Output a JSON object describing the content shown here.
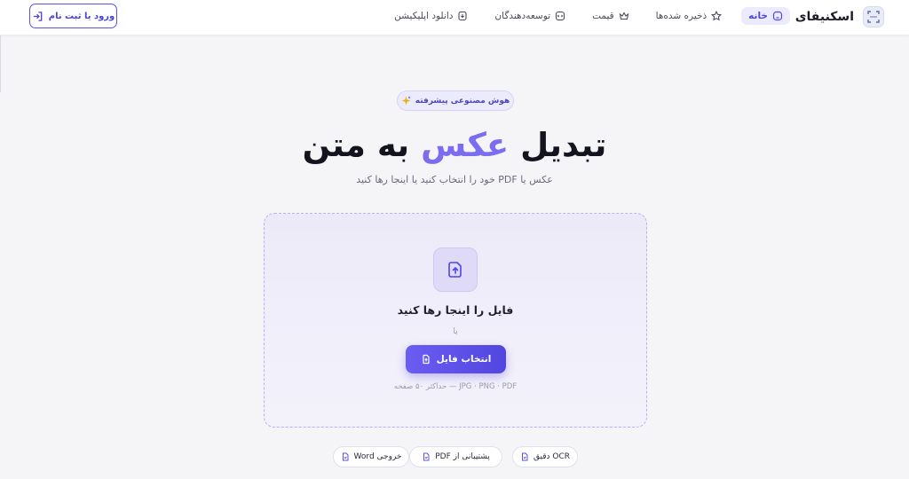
{
  "header": {
    "brand": "اسکنیفای",
    "nav": [
      {
        "label": "خانه",
        "icon": "home-icon",
        "active": true
      },
      {
        "label": "ذخیره شده‌ها",
        "icon": "star-icon",
        "active": false
      },
      {
        "label": "قیمت",
        "icon": "crown-icon",
        "active": false
      },
      {
        "label": "توسعه‌دهندگان",
        "icon": "code-icon",
        "active": false
      },
      {
        "label": "دانلود اپلیکیشن",
        "icon": "phone-icon",
        "active": false
      }
    ],
    "login_label": "ورود یا ثبت نام"
  },
  "hero": {
    "badge": "هوش مصنوعی پیشرفته",
    "title_prefix": "تبدیل",
    "title_highlight": "عکس",
    "title_suffix": "به متن",
    "subtitle": "عکس یا PDF خود را انتخاب کنید یا اینجا رها کنید"
  },
  "dropzone": {
    "title": "فایل را اینجا رها کنید",
    "or": "یا",
    "button": "انتخاب فایل",
    "formats": "JPG · PNG · PDF — حداکثر ۵۰ صفحه"
  },
  "features": [
    {
      "label": "OCR دقیق"
    },
    {
      "label": "پشتیبانی از PDF"
    },
    {
      "label": "خروجی Word"
    }
  ],
  "colors": {
    "accent": "#5b52e6",
    "highlight": "#7b6cf0",
    "background": "#f5f5f8"
  }
}
